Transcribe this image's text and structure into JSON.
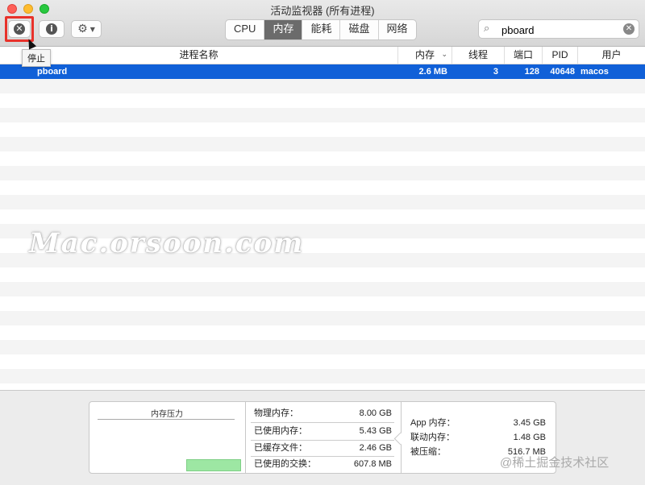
{
  "window": {
    "title": "活动监视器 (所有进程)"
  },
  "toolbar": {
    "stop_tooltip": "停止",
    "info_glyph": "i",
    "tabs": [
      "CPU",
      "内存",
      "能耗",
      "磁盘",
      "网络"
    ],
    "active_tab": "内存",
    "search_value": "pboard"
  },
  "table": {
    "columns": {
      "name": "进程名称",
      "memory": "内存",
      "threads": "线程",
      "ports": "端口",
      "pid": "PID",
      "user": "用户"
    },
    "rows": [
      {
        "name": "pboard",
        "memory": "2.6 MB",
        "threads": "3",
        "ports": "128",
        "pid": "40648",
        "user": "macos"
      }
    ]
  },
  "watermark": "Mac.orsoon.com",
  "memory_panel": {
    "pressure_title": "内存压力",
    "physical_label": "物理内存：",
    "physical_value": "8.00 GB",
    "used_label": "已使用内存：",
    "used_value": "5.43 GB",
    "cached_label": "已缓存文件：",
    "cached_value": "2.46 GB",
    "swap_label": "已使用的交换：",
    "swap_value": "607.8 MB",
    "app_label": "App 内存：",
    "app_value": "3.45 GB",
    "wired_label": "联动内存：",
    "wired_value": "1.48 GB",
    "compressed_label": "被压缩：",
    "compressed_value": "516.7 MB"
  },
  "footer_credit": "@稀土掘金技术社区",
  "colors": {
    "selection": "#1060d8",
    "active_tab": "#6b6b6b",
    "stop_highlight": "#e8312a",
    "pressure_green": "#9de7a3"
  }
}
